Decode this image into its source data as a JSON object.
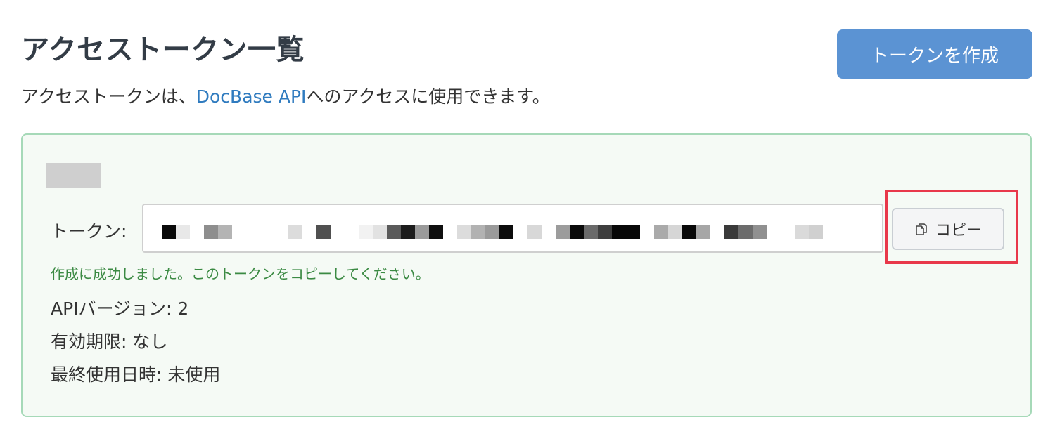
{
  "header": {
    "title": "アクセストークン一覧",
    "create_label": "トークンを作成"
  },
  "description": {
    "prefix": "アクセストークンは、",
    "link_text": "DocBase API",
    "suffix": "へのアクセスに使用できます。"
  },
  "token": {
    "label": "トークン:",
    "copy_label": "コピー",
    "copy_icon": "copy-icon",
    "success_message": "作成に成功しました。このトークンをコピーしてください。",
    "api_version": "APIバージョン:  2",
    "expiry": "有効期限:  なし",
    "last_used": "最終使用日時: 未使用"
  },
  "colors": {
    "primary": "#5b93d3",
    "link": "#2f7bbf",
    "success": "#3b8a43",
    "panel_bg": "#f5faf5",
    "panel_border": "#a6d9b8",
    "highlight": "#e8384a"
  }
}
